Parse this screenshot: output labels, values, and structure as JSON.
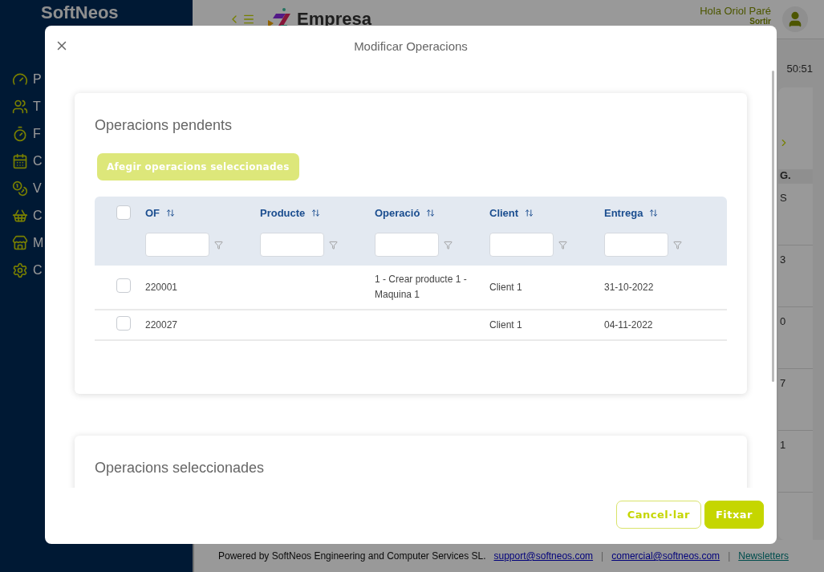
{
  "app": {
    "logo": "SoftNeos",
    "brand": "Empresa",
    "greeting": "Hola Oriol Paré",
    "logout": "Sortir"
  },
  "sidebar": {
    "items": [
      {
        "label": "P"
      },
      {
        "label": "T"
      },
      {
        "label": "F"
      },
      {
        "label": "C"
      },
      {
        "label": "V"
      },
      {
        "label": "C"
      },
      {
        "label": "M"
      },
      {
        "label": "C"
      }
    ]
  },
  "background": {
    "time": "50:51",
    "column_head": "G.",
    "cells": [
      "S",
      "3",
      "0",
      "7",
      "1"
    ]
  },
  "modal": {
    "title": "Modificar Operacions",
    "sections": [
      {
        "title": "Operacions pendents",
        "add_button": {
          "label": "Afegir operacions seleccionades",
          "disabled": true
        },
        "all_selected": false,
        "columns": [
          "OF",
          "Producte",
          "Operació",
          "Client",
          "Entrega"
        ],
        "rows": [
          {
            "selected": false,
            "cells": [
              "220001",
              "",
              "1 - Crear producte 1 - Maquina 1",
              "Client 1",
              "31-10-2022"
            ]
          },
          {
            "selected": false,
            "cells": [
              "220027",
              "",
              "",
              "Client 1",
              "04-11-2022"
            ]
          }
        ]
      },
      {
        "title": "Operacions seleccionades"
      }
    ],
    "buttons": {
      "cancel": "Cancel·lar",
      "confirm": "Fitxar"
    }
  },
  "footer": {
    "text": "Powered by SoftNeos Engineering and Computer Services SL.",
    "links": [
      "support@softneos.com",
      "comercial@softneos.com",
      "Newsletters"
    ],
    "separators": [
      "|",
      "|"
    ]
  }
}
